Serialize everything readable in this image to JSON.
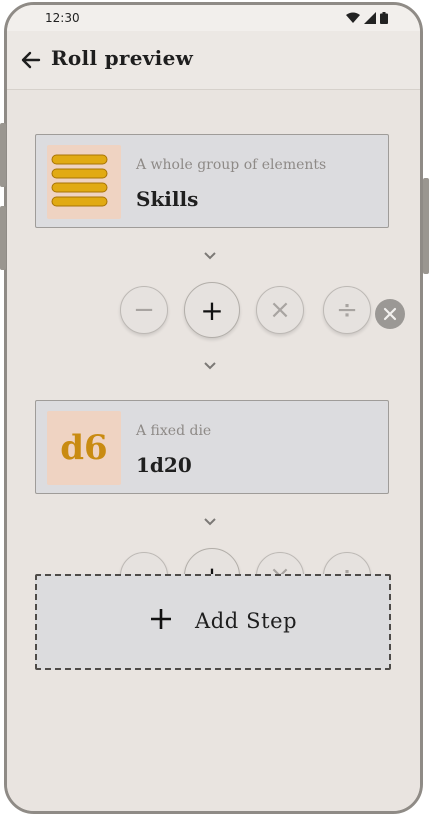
{
  "status_bar": {
    "time": "12:30"
  },
  "app_bar": {
    "title": "Roll preview"
  },
  "steps": [
    {
      "subtitle": "A whole group of elements",
      "title": "Skills",
      "icon": "stacked-bars-icon"
    },
    {
      "subtitle": "A fixed die",
      "title": "1d20",
      "icon": "d6-die-icon",
      "icon_text": "d6"
    }
  ],
  "operators": [
    {
      "symbol": "−",
      "name": "subtract"
    },
    {
      "symbol": "+",
      "name": "add",
      "selected": true
    },
    {
      "symbol": "×",
      "name": "multiply"
    },
    {
      "symbol": "÷",
      "name": "divide"
    }
  ],
  "add_step": {
    "label": "Add Step"
  },
  "colors": {
    "accent": "#d9a117",
    "bar_gold": "#e1aa13",
    "frame": "#8f8b86"
  }
}
